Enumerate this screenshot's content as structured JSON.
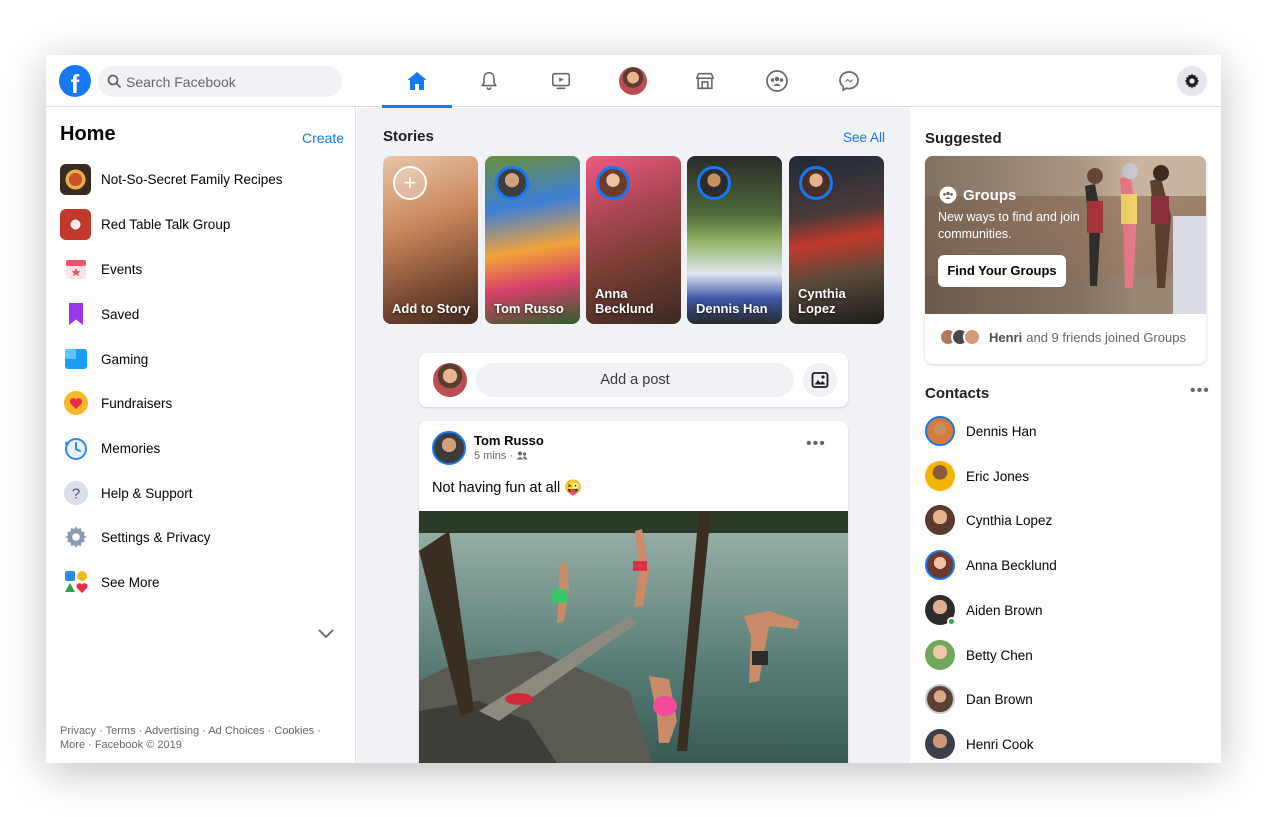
{
  "app": {
    "brand_letter": "f"
  },
  "search": {
    "placeholder": "Search Facebook"
  },
  "nav": {
    "tabs": [
      {
        "icon": "home-icon",
        "active": true
      },
      {
        "icon": "bell-icon",
        "active": false
      },
      {
        "icon": "watch-icon",
        "active": false
      },
      {
        "icon": "profile-avatar",
        "active": false
      },
      {
        "icon": "marketplace-icon",
        "active": false
      },
      {
        "icon": "groups-icon",
        "active": false
      },
      {
        "icon": "messenger-icon",
        "active": false
      }
    ],
    "settings_icon": "gear-icon",
    "accent_color": "#1877f2"
  },
  "left": {
    "title": "Home",
    "create_label": "Create",
    "items": [
      {
        "label": "Not-So-Secret Family Recipes",
        "icon": "group-photo"
      },
      {
        "label": "Red Table Talk Group",
        "icon": "group-photo"
      },
      {
        "label": "Events",
        "icon": "calendar-star-icon"
      },
      {
        "label": "Saved",
        "icon": "bookmark-icon"
      },
      {
        "label": "Gaming",
        "icon": "gaming-icon"
      },
      {
        "label": "Fundraisers",
        "icon": "heart-coin-icon"
      },
      {
        "label": "Memories",
        "icon": "clock-icon"
      },
      {
        "label": "Help & Support",
        "icon": "question-icon"
      },
      {
        "label": "Settings & Privacy",
        "icon": "gear-icon"
      },
      {
        "label": "See More",
        "icon": "shapes-icon"
      }
    ],
    "footer": "Privacy · Terms · Advertising · Ad Choices · Cookies · More · Facebook © 2019"
  },
  "stories": {
    "title": "Stories",
    "see_all": "See All",
    "items": [
      {
        "name": "Add to Story"
      },
      {
        "name": "Tom Russo"
      },
      {
        "name": "Anna Becklund"
      },
      {
        "name": "Dennis Han"
      },
      {
        "name": "Cynthia Lopez"
      }
    ]
  },
  "composer": {
    "add_post_label": "Add a post"
  },
  "post": {
    "author": "Tom Russo",
    "time": "5 mins ·",
    "text": "Not having fun at all",
    "emoji": "😜"
  },
  "suggested": {
    "title": "Suggested",
    "groups_heading": "Groups",
    "groups_sub": "New ways to find and join communities.",
    "find_button": "Find Your Groups",
    "friends_name": "Henri",
    "friends_text": "and 9 friends joined Groups"
  },
  "contacts": {
    "title": "Contacts",
    "items": [
      {
        "name": "Dennis Han"
      },
      {
        "name": "Eric Jones"
      },
      {
        "name": "Cynthia Lopez"
      },
      {
        "name": "Anna Becklund"
      },
      {
        "name": "Aiden Brown"
      },
      {
        "name": "Betty Chen"
      },
      {
        "name": "Dan Brown"
      },
      {
        "name": "Henri Cook"
      }
    ]
  }
}
